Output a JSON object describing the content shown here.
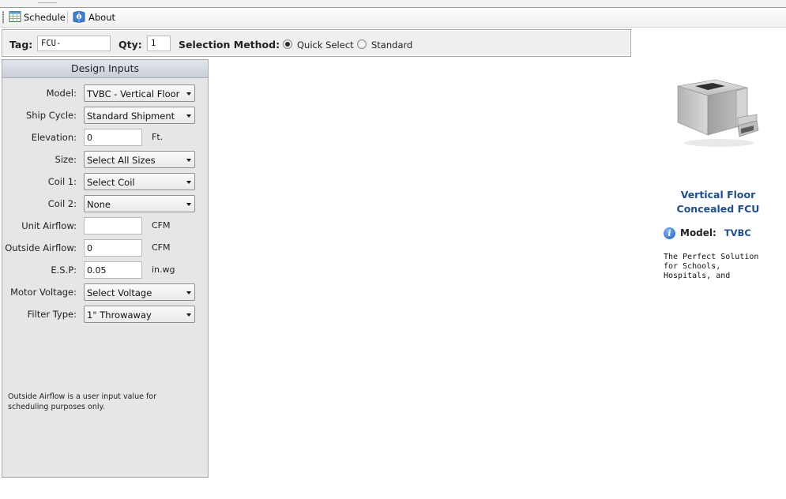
{
  "toolbar": {
    "schedule_label": "Schedule",
    "about_label": "About"
  },
  "tagbar": {
    "tag_label": "Tag:",
    "tag_value": "FCU-",
    "qty_label": "Qty:",
    "qty_value": "1",
    "method_label": "Selection Method:",
    "method_options": [
      "Quick Select",
      "Standard"
    ],
    "method_selected": "Quick Select"
  },
  "design_inputs": {
    "title": "Design Inputs",
    "fields": [
      {
        "label": "Model:",
        "value": "TVBC - Vertical Floor Concealed FCU"
      },
      {
        "label": "Ship Cycle:",
        "value": "Standard Shipment"
      },
      {
        "label": "Elevation:",
        "value": "0",
        "unit": "Ft."
      },
      {
        "label": "Size:",
        "value": "Select All Sizes"
      },
      {
        "label": "Coil 1:",
        "value": "Select Coil"
      },
      {
        "label": "Coil 2:",
        "value": "None"
      },
      {
        "label": "Unit Airflow:",
        "value": "",
        "unit": "CFM"
      },
      {
        "label": "Outside Airflow:",
        "value": "0",
        "unit": "CFM"
      },
      {
        "label": "E.S.P:",
        "value": "0.05",
        "unit": "in.wg"
      },
      {
        "label": "Motor Voltage:",
        "value": "Select Voltage"
      },
      {
        "label": "Filter Type:",
        "value": "1\" Throwaway"
      }
    ],
    "note": "Outside Airflow is a user input value for scheduling purposes only."
  },
  "product": {
    "title_line1": "Vertical Floor",
    "title_line2": "Concealed FCU",
    "model_label": "Model:",
    "model_value": "TVBC",
    "description": "The Perfect Solution\nfor Schools,\nHospitals, and"
  },
  "colors": {
    "accent_blue": "#1f4e8c",
    "panel_bg": "#e6e6e6",
    "header_bg": "#c9ced8"
  },
  "icons": {
    "schedule": "spreadsheet-icon",
    "about": "book-info-icon",
    "info": "info-icon"
  }
}
